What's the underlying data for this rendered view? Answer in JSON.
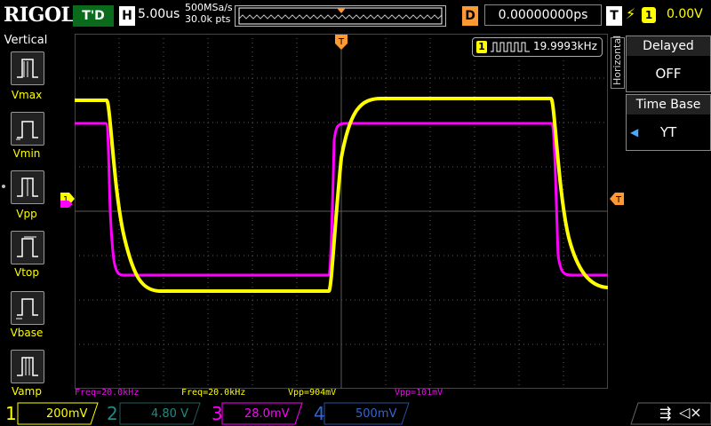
{
  "header": {
    "logo": "RIGOL",
    "run_state": "T'D",
    "h_label": "H",
    "timebase": "5.00us",
    "sample_rate": "500MSa/s",
    "points": "30.0k pts",
    "d_label": "D",
    "delay": "0.00000000ps",
    "t_label": "T",
    "trigger_source": "1",
    "trigger_level": "0.00V"
  },
  "left_panel": {
    "title": "Vertical",
    "items": [
      {
        "label": "Vmax"
      },
      {
        "label": "Vmin"
      },
      {
        "label": "Vpp"
      },
      {
        "label": "Vtop"
      },
      {
        "label": "Vbase"
      },
      {
        "label": "Vamp"
      }
    ]
  },
  "right_panel": {
    "tab_label": "Horizontal",
    "delayed_title": "Delayed",
    "delayed_value": "OFF",
    "timebase_title": "Time Base",
    "timebase_value": "YT"
  },
  "frequency_counter": {
    "channel": "1",
    "value": "19.9993kHz"
  },
  "measurements": [
    {
      "text": "Freq=20.0kHz",
      "color": "#ff00ff"
    },
    {
      "text": "Freq=20.0kHz",
      "color": "#ffff00"
    },
    {
      "text": "Vpp=904mV",
      "color": "#ffff00"
    },
    {
      "text": "Vpp=101mV",
      "color": "#ff00ff"
    }
  ],
  "channels": [
    {
      "num": "1",
      "scale": "200mV",
      "color": "#ffff00"
    },
    {
      "num": "2",
      "scale": "4.80 V",
      "color": "#1f8c84"
    },
    {
      "num": "3",
      "scale": "28.0mV",
      "color": "#ff00ff"
    },
    {
      "num": "4",
      "scale": "500mV",
      "color": "#3366cc"
    }
  ],
  "markers": {
    "ch1_marker": "1",
    "trigger_marker": "T"
  },
  "colors": {
    "ch1": "#ffff00",
    "ch3": "#ff00ff",
    "trigger": "#ff9933",
    "grid": "#5a5a5a"
  }
}
